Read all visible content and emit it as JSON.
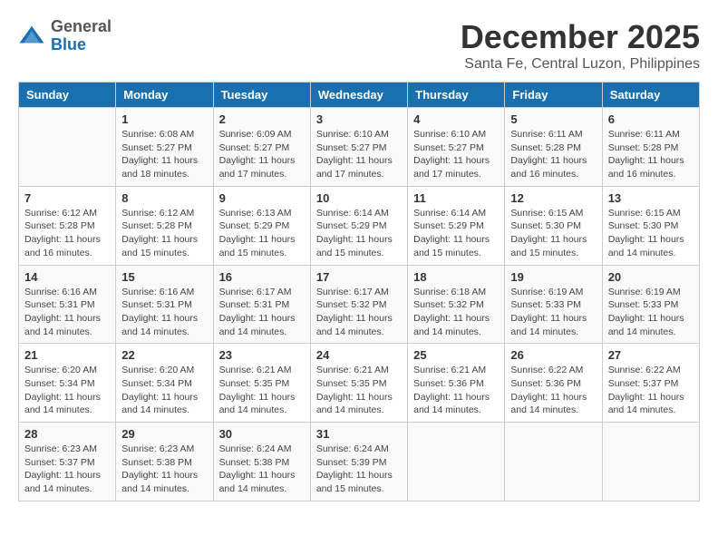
{
  "header": {
    "logo_general": "General",
    "logo_blue": "Blue",
    "month_title": "December 2025",
    "location": "Santa Fe, Central Luzon, Philippines"
  },
  "weekdays": [
    "Sunday",
    "Monday",
    "Tuesday",
    "Wednesday",
    "Thursday",
    "Friday",
    "Saturday"
  ],
  "weeks": [
    [
      {
        "day": "",
        "info": ""
      },
      {
        "day": "1",
        "info": "Sunrise: 6:08 AM\nSunset: 5:27 PM\nDaylight: 11 hours and 18 minutes."
      },
      {
        "day": "2",
        "info": "Sunrise: 6:09 AM\nSunset: 5:27 PM\nDaylight: 11 hours and 17 minutes."
      },
      {
        "day": "3",
        "info": "Sunrise: 6:10 AM\nSunset: 5:27 PM\nDaylight: 11 hours and 17 minutes."
      },
      {
        "day": "4",
        "info": "Sunrise: 6:10 AM\nSunset: 5:27 PM\nDaylight: 11 hours and 17 minutes."
      },
      {
        "day": "5",
        "info": "Sunrise: 6:11 AM\nSunset: 5:28 PM\nDaylight: 11 hours and 16 minutes."
      },
      {
        "day": "6",
        "info": "Sunrise: 6:11 AM\nSunset: 5:28 PM\nDaylight: 11 hours and 16 minutes."
      }
    ],
    [
      {
        "day": "7",
        "info": "Sunrise: 6:12 AM\nSunset: 5:28 PM\nDaylight: 11 hours and 16 minutes."
      },
      {
        "day": "8",
        "info": "Sunrise: 6:12 AM\nSunset: 5:28 PM\nDaylight: 11 hours and 15 minutes."
      },
      {
        "day": "9",
        "info": "Sunrise: 6:13 AM\nSunset: 5:29 PM\nDaylight: 11 hours and 15 minutes."
      },
      {
        "day": "10",
        "info": "Sunrise: 6:14 AM\nSunset: 5:29 PM\nDaylight: 11 hours and 15 minutes."
      },
      {
        "day": "11",
        "info": "Sunrise: 6:14 AM\nSunset: 5:29 PM\nDaylight: 11 hours and 15 minutes."
      },
      {
        "day": "12",
        "info": "Sunrise: 6:15 AM\nSunset: 5:30 PM\nDaylight: 11 hours and 15 minutes."
      },
      {
        "day": "13",
        "info": "Sunrise: 6:15 AM\nSunset: 5:30 PM\nDaylight: 11 hours and 14 minutes."
      }
    ],
    [
      {
        "day": "14",
        "info": "Sunrise: 6:16 AM\nSunset: 5:31 PM\nDaylight: 11 hours and 14 minutes."
      },
      {
        "day": "15",
        "info": "Sunrise: 6:16 AM\nSunset: 5:31 PM\nDaylight: 11 hours and 14 minutes."
      },
      {
        "day": "16",
        "info": "Sunrise: 6:17 AM\nSunset: 5:31 PM\nDaylight: 11 hours and 14 minutes."
      },
      {
        "day": "17",
        "info": "Sunrise: 6:17 AM\nSunset: 5:32 PM\nDaylight: 11 hours and 14 minutes."
      },
      {
        "day": "18",
        "info": "Sunrise: 6:18 AM\nSunset: 5:32 PM\nDaylight: 11 hours and 14 minutes."
      },
      {
        "day": "19",
        "info": "Sunrise: 6:19 AM\nSunset: 5:33 PM\nDaylight: 11 hours and 14 minutes."
      },
      {
        "day": "20",
        "info": "Sunrise: 6:19 AM\nSunset: 5:33 PM\nDaylight: 11 hours and 14 minutes."
      }
    ],
    [
      {
        "day": "21",
        "info": "Sunrise: 6:20 AM\nSunset: 5:34 PM\nDaylight: 11 hours and 14 minutes."
      },
      {
        "day": "22",
        "info": "Sunrise: 6:20 AM\nSunset: 5:34 PM\nDaylight: 11 hours and 14 minutes."
      },
      {
        "day": "23",
        "info": "Sunrise: 6:21 AM\nSunset: 5:35 PM\nDaylight: 11 hours and 14 minutes."
      },
      {
        "day": "24",
        "info": "Sunrise: 6:21 AM\nSunset: 5:35 PM\nDaylight: 11 hours and 14 minutes."
      },
      {
        "day": "25",
        "info": "Sunrise: 6:21 AM\nSunset: 5:36 PM\nDaylight: 11 hours and 14 minutes."
      },
      {
        "day": "26",
        "info": "Sunrise: 6:22 AM\nSunset: 5:36 PM\nDaylight: 11 hours and 14 minutes."
      },
      {
        "day": "27",
        "info": "Sunrise: 6:22 AM\nSunset: 5:37 PM\nDaylight: 11 hours and 14 minutes."
      }
    ],
    [
      {
        "day": "28",
        "info": "Sunrise: 6:23 AM\nSunset: 5:37 PM\nDaylight: 11 hours and 14 minutes."
      },
      {
        "day": "29",
        "info": "Sunrise: 6:23 AM\nSunset: 5:38 PM\nDaylight: 11 hours and 14 minutes."
      },
      {
        "day": "30",
        "info": "Sunrise: 6:24 AM\nSunset: 5:38 PM\nDaylight: 11 hours and 14 minutes."
      },
      {
        "day": "31",
        "info": "Sunrise: 6:24 AM\nSunset: 5:39 PM\nDaylight: 11 hours and 15 minutes."
      },
      {
        "day": "",
        "info": ""
      },
      {
        "day": "",
        "info": ""
      },
      {
        "day": "",
        "info": ""
      }
    ]
  ]
}
